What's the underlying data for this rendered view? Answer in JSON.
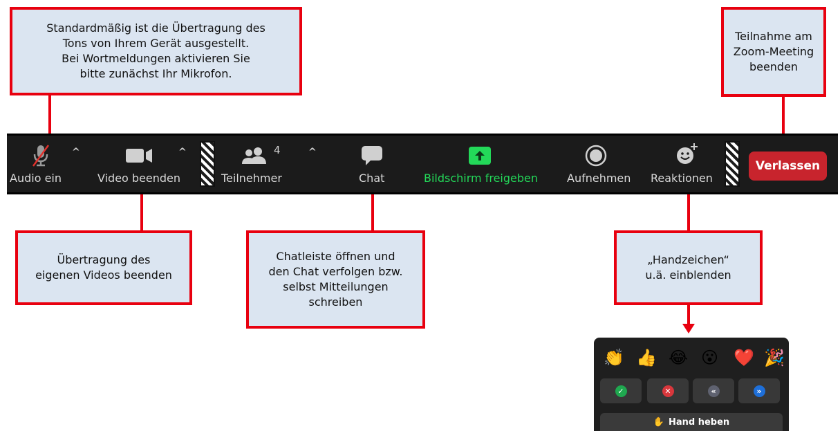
{
  "callouts": {
    "audio": "Standardmäßig ist die Übertragung des\nTons von Ihrem Gerät ausgestellt.\nBei Wortmeldungen aktivieren Sie\nbitte zunächst Ihr Mikrofon.",
    "leave": "Teilnahme am\nZoom-Meeting\nbeenden",
    "video": "Übertragung des\neigenen Videos beenden",
    "chat": "Chatleiste öffnen und\nden Chat verfolgen bzw.\nselbst Mitteilungen\nschreiben",
    "reactions": "„Handzeichen“\nu.ä. einblenden"
  },
  "toolbar": {
    "audio_label": "Audio ein",
    "video_label": "Video beenden",
    "participants_label": "Teilnehmer",
    "participants_count": "4",
    "chat_label": "Chat",
    "share_label": "Bildschirm freigeben",
    "record_label": "Aufnehmen",
    "reactions_label": "Reaktionen",
    "leave_label": "Verlassen",
    "caret": "^"
  },
  "reactions_panel": {
    "emojis": [
      "👏",
      "👍",
      "😂",
      "😮",
      "❤️",
      "🎉"
    ],
    "status_buttons": [
      {
        "icon": "✓",
        "color": "#1fa84f"
      },
      {
        "icon": "✕",
        "color": "#d9373c"
      },
      {
        "icon": "«",
        "color": "#5f6270"
      },
      {
        "icon": "»",
        "color": "#1e6fd9"
      }
    ],
    "raise_hand_icon": "✋",
    "raise_hand_label": "Hand heben"
  },
  "colors": {
    "callout_border": "#e8000f",
    "callout_fill": "#dbe5f1",
    "toolbar_bg": "#1b1b1b",
    "share_green": "#23d959",
    "leave_red": "#c8242d"
  }
}
